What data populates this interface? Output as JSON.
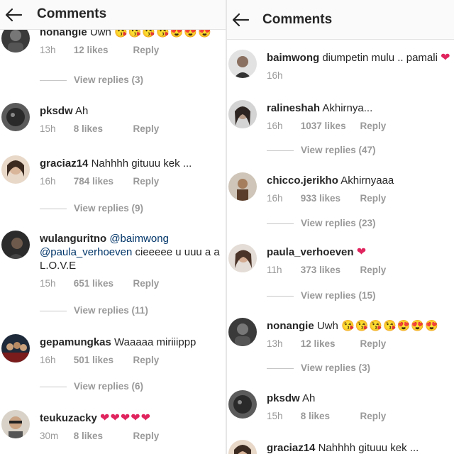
{
  "left": {
    "header": {
      "title": "Comments"
    },
    "comments": [
      {
        "username": "nonangie",
        "text": "Uwh",
        "emojis": "😘😘😘😘😍😍😍",
        "time": "13h",
        "likes": "12 likes",
        "reply": "Reply",
        "view_replies": "View replies (3)"
      },
      {
        "username": "pksdw",
        "text": "Ah",
        "time": "15h",
        "likes": "8 likes",
        "reply": "Reply"
      },
      {
        "username": "graciaz14",
        "text": "Nahhhh gituuu kek ...",
        "time": "16h",
        "likes": "784 likes",
        "reply": "Reply",
        "view_replies": "View replies (9)"
      },
      {
        "username": "wulanguritno",
        "mention1": "@baimwong",
        "mention2": "@paula_verhoeven",
        "text": "cieeeee u uuu a a L.O.V.E",
        "time": "15h",
        "likes": "651 likes",
        "reply": "Reply",
        "view_replies": "View replies (11)"
      },
      {
        "username": "gepamungkas",
        "text": "Waaaaa miriiippp",
        "time": "16h",
        "likes": "501 likes",
        "reply": "Reply",
        "view_replies": "View replies (6)"
      },
      {
        "username": "teukuzacky",
        "hearts": "❤❤❤❤❤",
        "time": "30m",
        "likes": "8 likes",
        "reply": "Reply"
      }
    ]
  },
  "right": {
    "header": {
      "title": "Comments"
    },
    "comments": [
      {
        "username": "baimwong",
        "text": "diumpetin mulu .. pamali",
        "hearts": "❤",
        "time": "16h"
      },
      {
        "username": "ralineshah",
        "text": "Akhirnya...",
        "time": "16h",
        "likes": "1037 likes",
        "reply": "Reply",
        "view_replies": "View replies (47)"
      },
      {
        "username": "chicco.jerikho",
        "text": "Akhirnyaaa",
        "time": "16h",
        "likes": "933 likes",
        "reply": "Reply",
        "view_replies": "View replies (23)"
      },
      {
        "username": "paula_verhoeven",
        "hearts": "❤",
        "time": "11h",
        "likes": "373 likes",
        "reply": "Reply",
        "view_replies": "View replies (15)"
      },
      {
        "username": "nonangie",
        "text": "Uwh",
        "emojis": "😘😘😘😘😍😍😍",
        "time": "13h",
        "likes": "12 likes",
        "reply": "Reply",
        "view_replies": "View replies (3)"
      },
      {
        "username": "pksdw",
        "text": "Ah",
        "time": "15h",
        "likes": "8 likes",
        "reply": "Reply"
      },
      {
        "username": "graciaz14",
        "text": "Nahhhh gituuu kek ..."
      }
    ]
  },
  "colors": {
    "text": "#262626",
    "meta": "#999999",
    "mention": "#003569",
    "heart": "#e0245e",
    "header_bg": "#fafafa"
  },
  "icons": {
    "back": "back-arrow-icon"
  }
}
